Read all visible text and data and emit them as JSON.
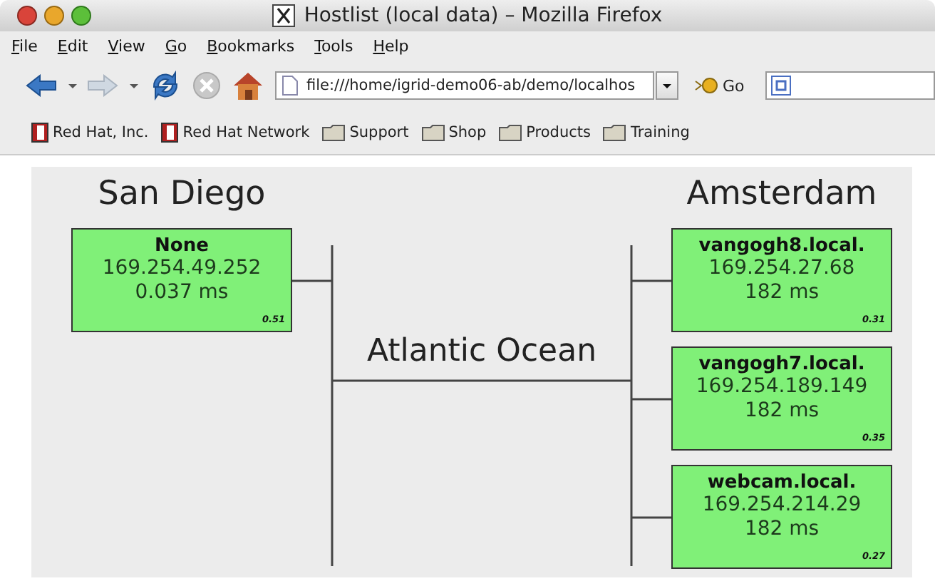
{
  "window": {
    "title": "Hostlist (local data) – Mozilla Firefox"
  },
  "menu": [
    "File",
    "Edit",
    "View",
    "Go",
    "Bookmarks",
    "Tools",
    "Help"
  ],
  "toolbar": {
    "url": "file:///home/igrid-demo06-ab/demo/localhos",
    "go": "Go"
  },
  "bookmarks": [
    {
      "label": "Red Hat, Inc.",
      "kind": "bookmark"
    },
    {
      "label": "Red Hat Network",
      "kind": "bookmark"
    },
    {
      "label": "Support",
      "kind": "folder"
    },
    {
      "label": "Shop",
      "kind": "folder"
    },
    {
      "label": "Products",
      "kind": "folder"
    },
    {
      "label": "Training",
      "kind": "folder"
    }
  ],
  "diagram": {
    "link": "Atlantic Ocean",
    "sites": [
      {
        "name": "San Diego",
        "hosts": [
          {
            "name": "None",
            "ip": "169.254.49.252",
            "latency": "0.037 ms",
            "score": "0.51"
          }
        ]
      },
      {
        "name": "Amsterdam",
        "hosts": [
          {
            "name": "vangogh8.local.",
            "ip": "169.254.27.68",
            "latency": "182 ms",
            "score": "0.31"
          },
          {
            "name": "vangogh7.local.",
            "ip": "169.254.189.149",
            "latency": "182 ms",
            "score": "0.35"
          },
          {
            "name": "webcam.local.",
            "ip": "169.254.214.29",
            "latency": "182 ms",
            "score": "0.27"
          }
        ]
      }
    ]
  }
}
